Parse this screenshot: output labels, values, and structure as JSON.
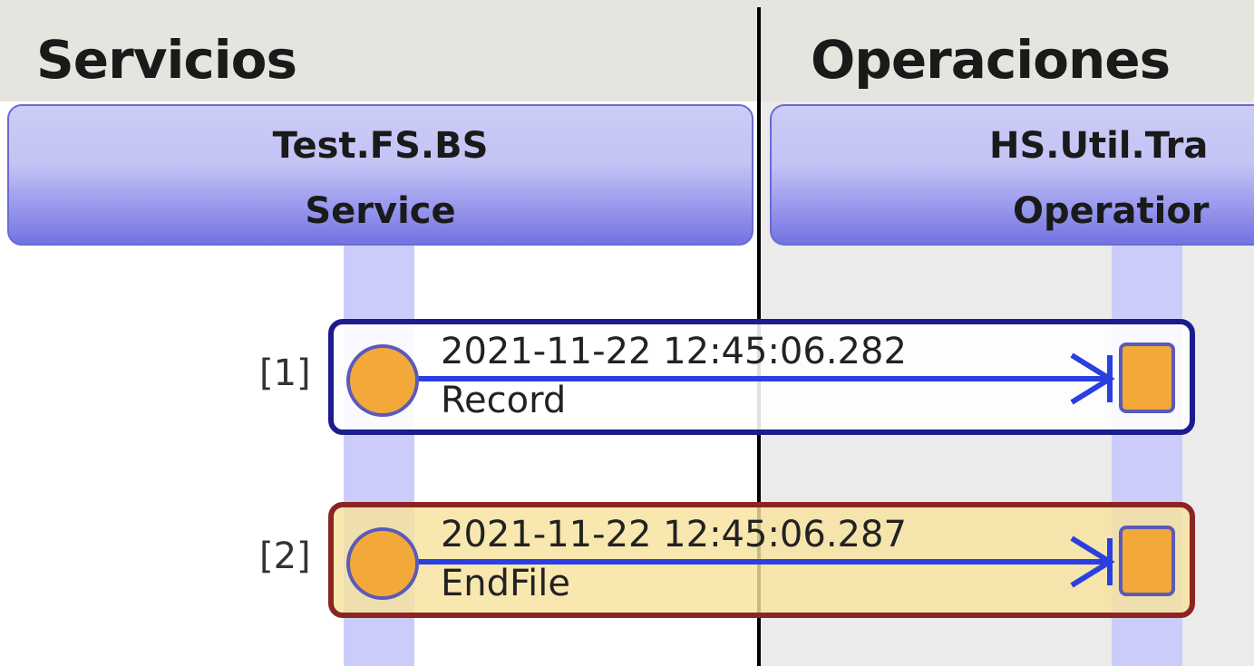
{
  "columns": {
    "servicios": {
      "title": "Servicios"
    },
    "operaciones": {
      "title": "Operaciones"
    }
  },
  "hosts": {
    "service": {
      "name": "Test.FS.BS",
      "type": "Service"
    },
    "operation": {
      "name": "HS.Util.Tra",
      "type": "Operatior"
    }
  },
  "messages": [
    {
      "index": "[1]",
      "timestamp": "2021-11-22 12:45:06.282",
      "name": "Record"
    },
    {
      "index": "[2]",
      "timestamp": "2021-11-22 12:45:06.287",
      "name": "EndFile"
    }
  ],
  "colors": {
    "msg1_border": "#1c1c8c",
    "msg2_border": "#8c2424",
    "msg2_fill": "#f6e29e",
    "arrow": "#2a3fe0",
    "node": "#f3a83a",
    "lifeline": "#ccccfa"
  },
  "icons": {
    "source": "circle-node-icon",
    "target": "square-node-icon",
    "arrow": "arrow-right-icon"
  }
}
